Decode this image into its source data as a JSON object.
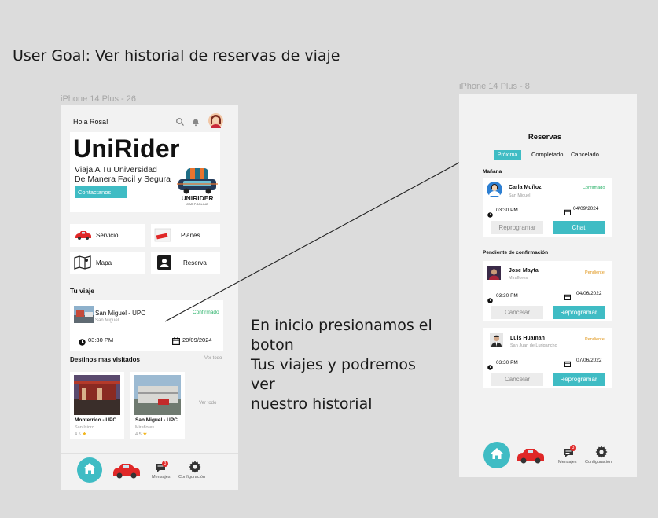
{
  "goal": "User Goal: Ver historial de reservas de viaje",
  "annotation": [
    "En inicio presionamos el",
    "boton",
    "Tus viajes y podremos",
    "ver",
    "nuestro historial"
  ],
  "home": {
    "frame_label": "iPhone 14 Plus - 26",
    "greeting": "Hola Rosa!",
    "banner": {
      "title": "UniRider",
      "subtitle_line1": "Viaja A Tu Universidad",
      "subtitle_line2": "De Manera Facil y Segura",
      "contact_label": "Contactanos",
      "logo_text": "UNIRIDER",
      "logo_sub": "CAR POOLING"
    },
    "menu": [
      "Servicio",
      "Planes",
      "Mapa",
      "Reserva"
    ],
    "trip": {
      "section_title": "Tu viaje",
      "route": "San Miguel - UPC",
      "district": "San Miguel",
      "status": "Confirmado",
      "time": "03:30 PM",
      "date": "20/09/2024"
    },
    "destinations": {
      "title": "Destinos mas visitados",
      "see_all": "Ver todo",
      "see_all_2": "Ver todo",
      "items": [
        {
          "name": "Monterrico  - UPC",
          "district": "San Isidro",
          "rating": "4.5"
        },
        {
          "name": "San Miguel - UPC",
          "district": "Miraflores",
          "rating": "4.5"
        }
      ]
    },
    "nav": {
      "messages": "Mensajes",
      "settings": "Configuración",
      "badge": "3"
    }
  },
  "reservas": {
    "frame_label": "iPhone 14 Plus - 8",
    "title": "Reservas",
    "tabs": [
      "Próxima",
      "Completado",
      "Cancelado"
    ],
    "section_today": "Mañana",
    "section_pending": "Pendiente de confirmación",
    "cards": [
      {
        "name": "Carla Muñoz",
        "district": "San Miguel",
        "status": "Confirmado",
        "time": "03:30 PM",
        "date": "04/09/2024",
        "btn_left": "Reprogramar",
        "btn_right": "Chat"
      },
      {
        "name": "Jose Mayta",
        "district": "Miraflores",
        "status": "Pendiente",
        "time": "03:30 PM",
        "date": "04/06/2022",
        "btn_left": "Cancelar",
        "btn_right": "Reprogramar"
      },
      {
        "name": "Luis Huaman",
        "district": "San Juan de Lurigancho",
        "status": "Pendiente",
        "time": "03:30 PM",
        "date": "07/06/2022",
        "btn_left": "Cancelar",
        "btn_right": "Reprogramar"
      }
    ],
    "nav": {
      "messages": "Mensajes",
      "settings": "Configuración",
      "badge": "3"
    }
  },
  "colors": {
    "teal": "#3fbcc4",
    "confirm": "#2db36b",
    "pending": "#e0961b",
    "nav_red": "#e02828"
  }
}
